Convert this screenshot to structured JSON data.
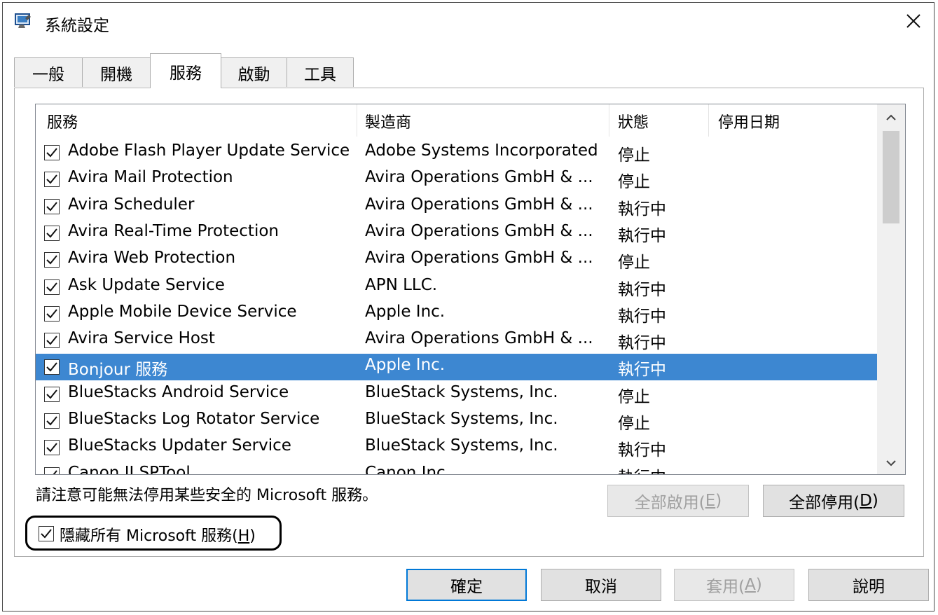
{
  "window": {
    "title": "系統設定",
    "close_glyph": "✕"
  },
  "tabs": [
    {
      "label": "一般"
    },
    {
      "label": "開機"
    },
    {
      "label": "服務",
      "active": true
    },
    {
      "label": "啟動"
    },
    {
      "label": "工具"
    }
  ],
  "services": {
    "columns": [
      "服務",
      "製造商",
      "狀態",
      "停用日期"
    ],
    "rows": [
      {
        "checked": true,
        "name": "Adobe Flash Player Update Service",
        "vendor": "Adobe Systems Incorporated",
        "status": "停止"
      },
      {
        "checked": true,
        "name": "Avira Mail Protection",
        "vendor": "Avira Operations GmbH & ...",
        "status": "停止"
      },
      {
        "checked": true,
        "name": "Avira Scheduler",
        "vendor": "Avira Operations GmbH & ...",
        "status": "執行中"
      },
      {
        "checked": true,
        "name": "Avira Real-Time Protection",
        "vendor": "Avira Operations GmbH & ...",
        "status": "執行中"
      },
      {
        "checked": true,
        "name": "Avira Web Protection",
        "vendor": "Avira Operations GmbH & ...",
        "status": "停止"
      },
      {
        "checked": true,
        "name": "Ask Update Service",
        "vendor": "APN LLC.",
        "status": "執行中"
      },
      {
        "checked": true,
        "name": "Apple Mobile Device Service",
        "vendor": "Apple Inc.",
        "status": "執行中"
      },
      {
        "checked": true,
        "name": "Avira Service Host",
        "vendor": "Avira Operations GmbH & ...",
        "status": "執行中"
      },
      {
        "checked": true,
        "name": "Bonjour 服務",
        "vendor": "Apple Inc.",
        "status": "執行中",
        "selected": true
      },
      {
        "checked": true,
        "name": "BlueStacks Android Service",
        "vendor": "BlueStack Systems, Inc.",
        "status": "停止"
      },
      {
        "checked": true,
        "name": "BlueStacks Log Rotator Service",
        "vendor": "BlueStack Systems, Inc.",
        "status": "停止"
      },
      {
        "checked": true,
        "name": "BlueStacks Updater Service",
        "vendor": "BlueStack Systems, Inc.",
        "status": "執行中"
      },
      {
        "checked": true,
        "name": "Canon IJ SPTool",
        "vendor": "Canon Inc.",
        "status": "執行中"
      }
    ]
  },
  "note": "請注意可能無法停用某些安全的 Microsoft 服務。",
  "enable_all": {
    "label": "全部啟用(",
    "key": "E",
    "end": ")"
  },
  "disable_all": {
    "label": "全部停用(",
    "key": "D",
    "end": ")"
  },
  "hide_ms": {
    "label": "隱藏所有 Microsoft 服務(",
    "key": "H",
    "end": ")",
    "checked": true
  },
  "footer": {
    "ok": "確定",
    "cancel": "取消",
    "apply": {
      "label": "套用(",
      "key": "A",
      "end": ")"
    },
    "help": "說明"
  },
  "colors": {
    "selection": "#3d87d1",
    "default_button_border": "#0078d7"
  }
}
